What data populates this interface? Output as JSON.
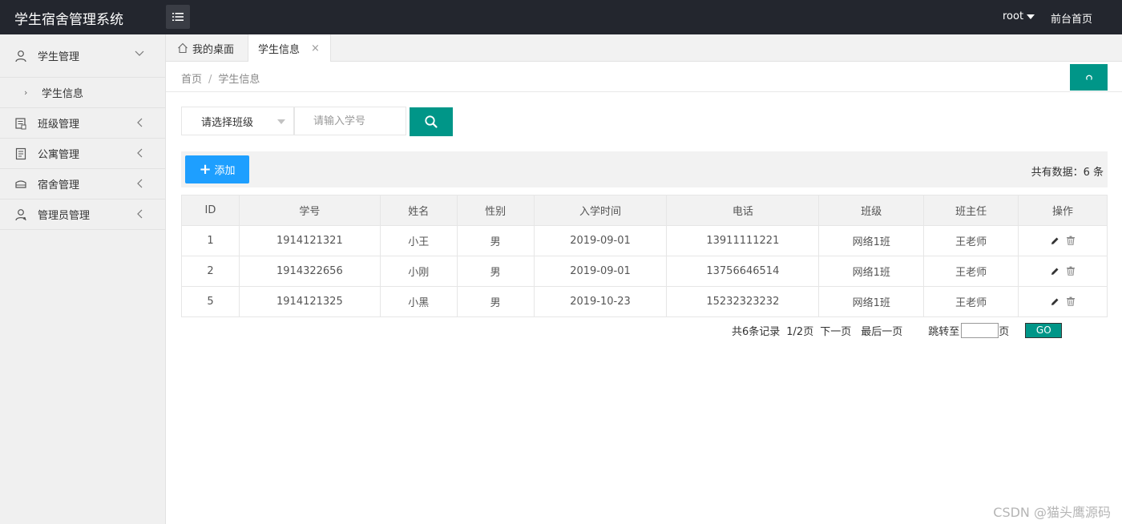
{
  "header": {
    "app_title": "学生宿舍管理系统",
    "user": "root",
    "front_link": "前台首页"
  },
  "sidebar": {
    "items": [
      {
        "label": "学生管理",
        "icon": "user-icon",
        "expanded": true,
        "children": [
          {
            "label": "学生信息"
          }
        ]
      },
      {
        "label": "班级管理",
        "icon": "class-icon"
      },
      {
        "label": "公寓管理",
        "icon": "building-icon"
      },
      {
        "label": "宿舍管理",
        "icon": "bed-icon"
      },
      {
        "label": "管理员管理",
        "icon": "admin-icon"
      }
    ]
  },
  "tabs": {
    "home": "我的桌面",
    "active": "学生信息",
    "close": "×"
  },
  "breadcrumb": {
    "home": "首页",
    "separator": "/",
    "current": "学生信息"
  },
  "search": {
    "class_select": "请选择班级",
    "sno_placeholder": "请输入学号"
  },
  "toolbar": {
    "add_label": "添加",
    "total_label": "共有数据：6 条"
  },
  "table": {
    "headers": [
      "ID",
      "学号",
      "姓名",
      "性别",
      "入学时间",
      "电话",
      "班级",
      "班主任",
      "操作"
    ],
    "rows": [
      {
        "id": "1",
        "sno": "1914121321",
        "name": "小王",
        "gender": "男",
        "enroll": "2019-09-01",
        "phone": "13911111221",
        "class": "网络1班",
        "teacher": "王老师"
      },
      {
        "id": "2",
        "sno": "1914322656",
        "name": "小刚",
        "gender": "男",
        "enroll": "2019-09-01",
        "phone": "13756646514",
        "class": "网络1班",
        "teacher": "王老师"
      },
      {
        "id": "5",
        "sno": "1914121325",
        "name": "小黑",
        "gender": "男",
        "enroll": "2019-10-23",
        "phone": "15232323232",
        "class": "网络1班",
        "teacher": "王老师"
      }
    ]
  },
  "pager": {
    "records": "共6条记录",
    "pages": "1/2页",
    "next": "下一页",
    "last": "最后一页",
    "jump_label": "跳转至",
    "page_suffix": "页",
    "go": "GO"
  },
  "watermark": "CSDN @猫头鹰源码",
  "colors": {
    "header_bg": "#23262e",
    "primary": "#009688",
    "add_button": "#1e9fff"
  }
}
